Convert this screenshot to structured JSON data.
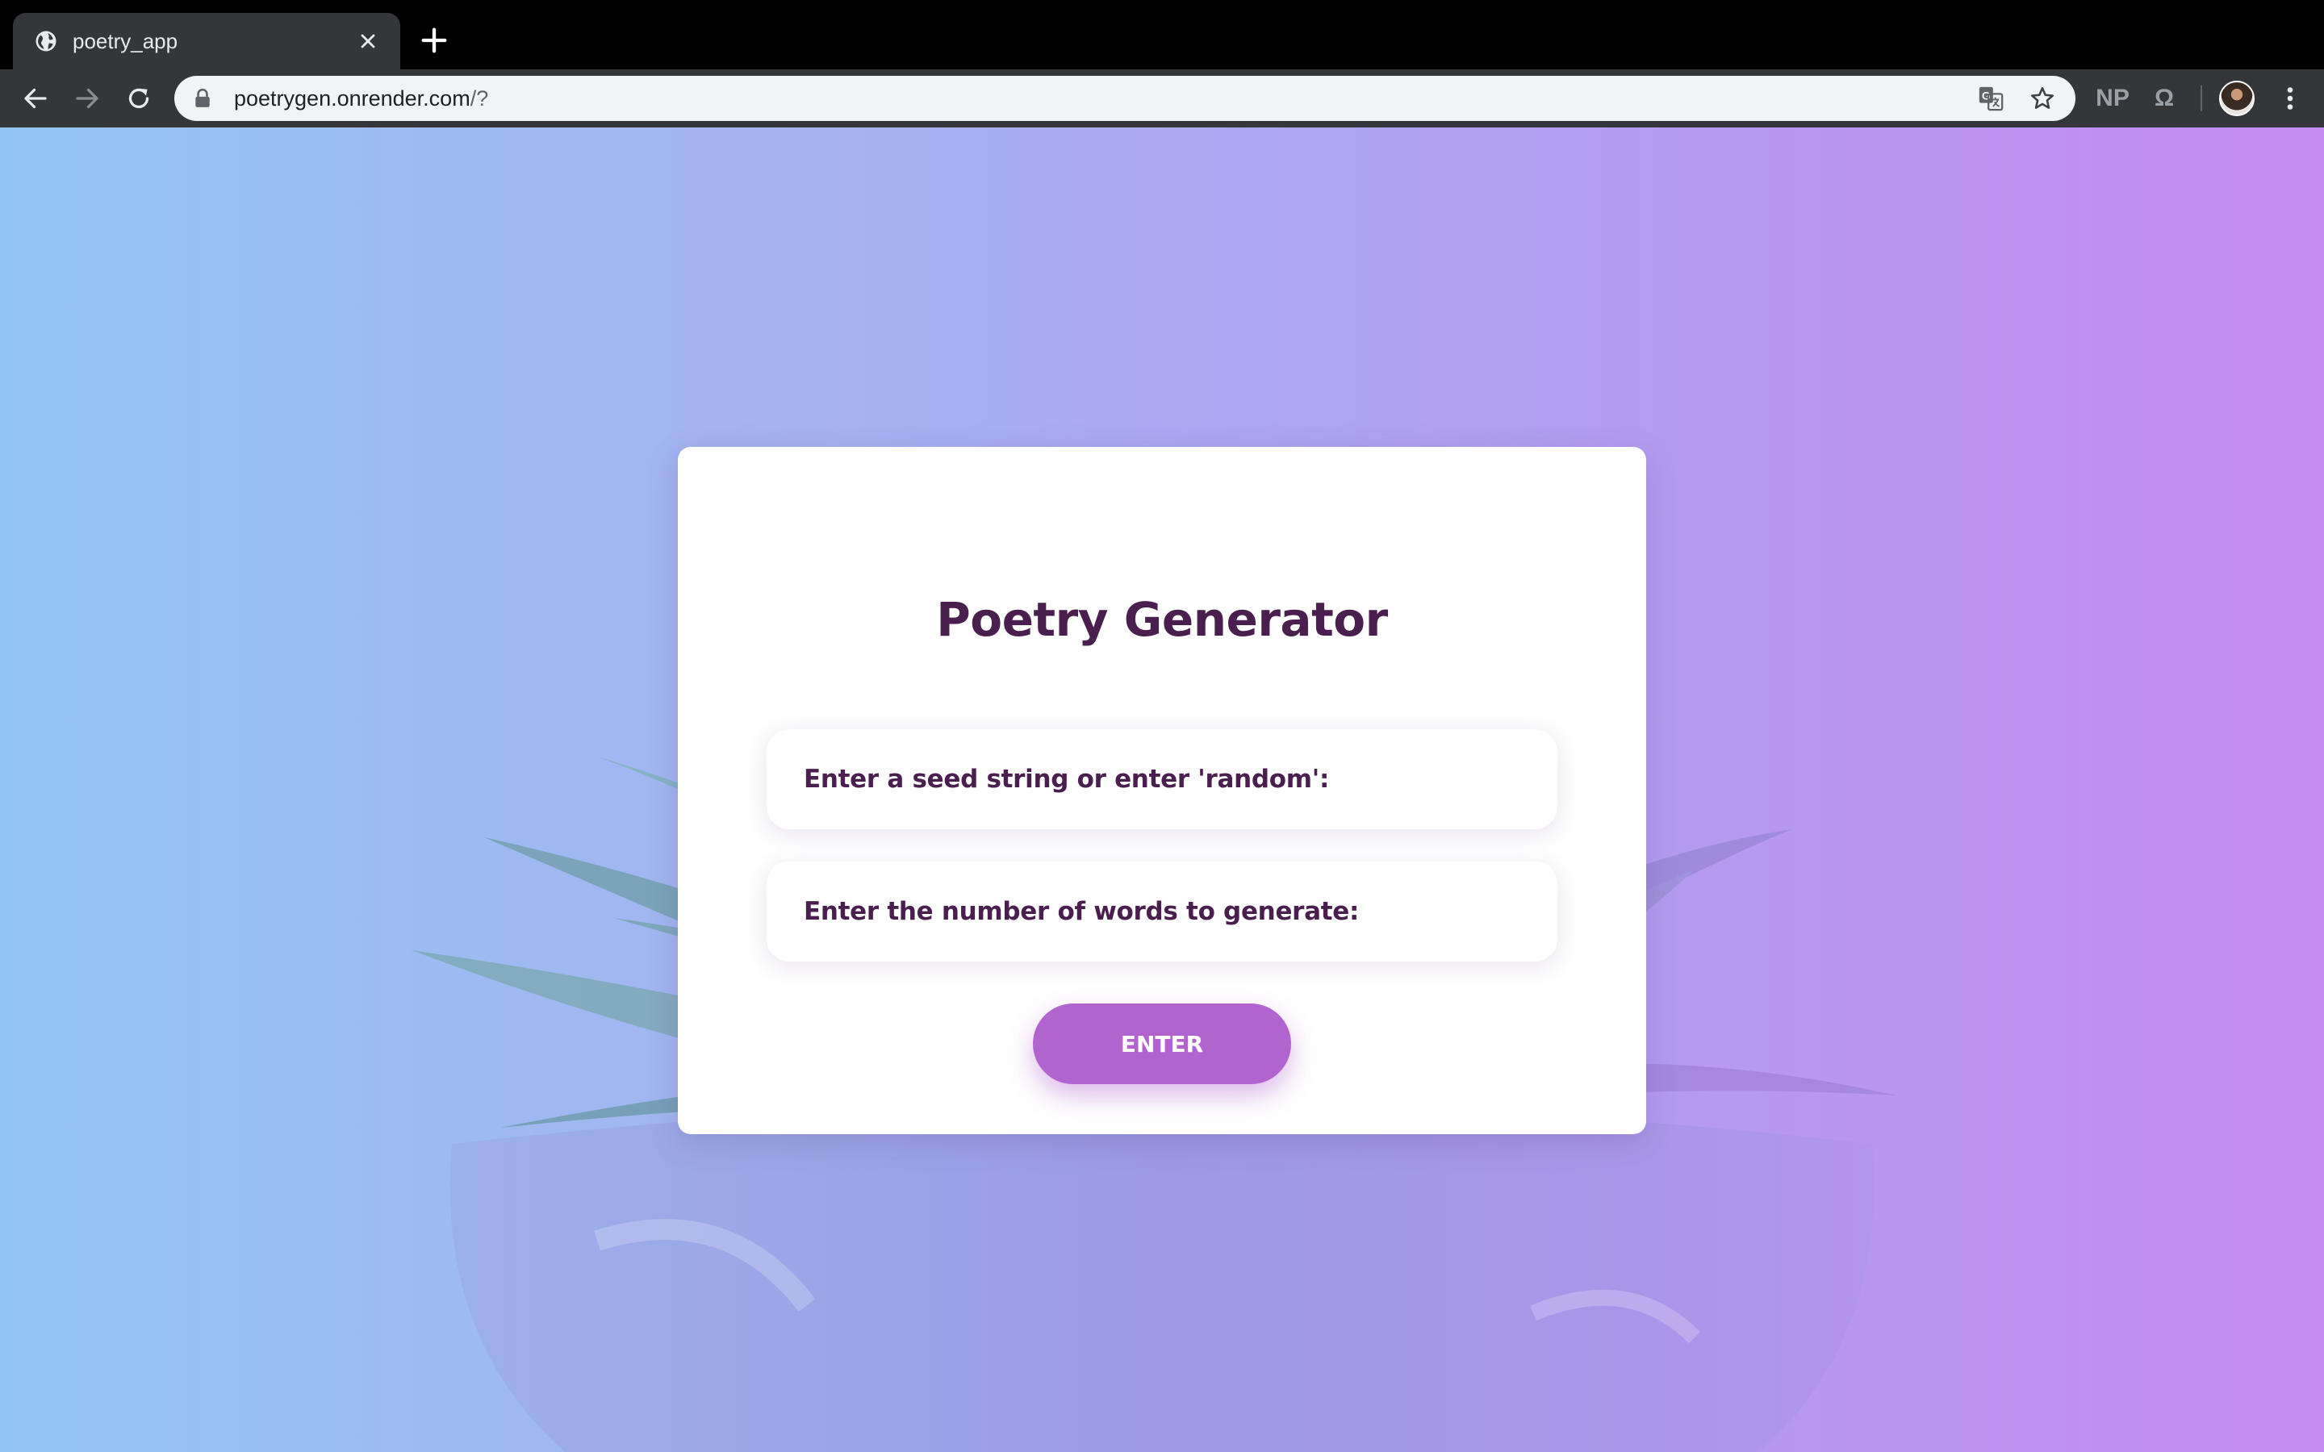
{
  "browser": {
    "tab": {
      "title": "poetry_app"
    },
    "address_bar": {
      "url_host": "poetrygen.onrender.com",
      "url_path": "/?"
    },
    "extensions": {
      "np_label": "NP",
      "omega_label": "Ω"
    },
    "icons": {
      "favicon": "globe-icon",
      "close": "close-icon",
      "new_tab": "plus-icon",
      "back": "arrow-left-icon",
      "forward": "arrow-right-icon",
      "reload": "reload-icon",
      "lock": "lock-icon",
      "translate": "translate-icon",
      "bookmark": "star-icon",
      "menu": "kebab-menu-icon"
    }
  },
  "page": {
    "title": "Poetry Generator",
    "seed_field": {
      "label": "Enter a seed string or enter 'random':"
    },
    "words_field": {
      "label": "Enter the number of words to generate:"
    },
    "submit": {
      "label": "ENTER"
    }
  },
  "colors": {
    "title_text": "#4a1e4f",
    "button": "#b163cf",
    "background_start": "#93c5f3",
    "background_end": "#c58bf0"
  }
}
